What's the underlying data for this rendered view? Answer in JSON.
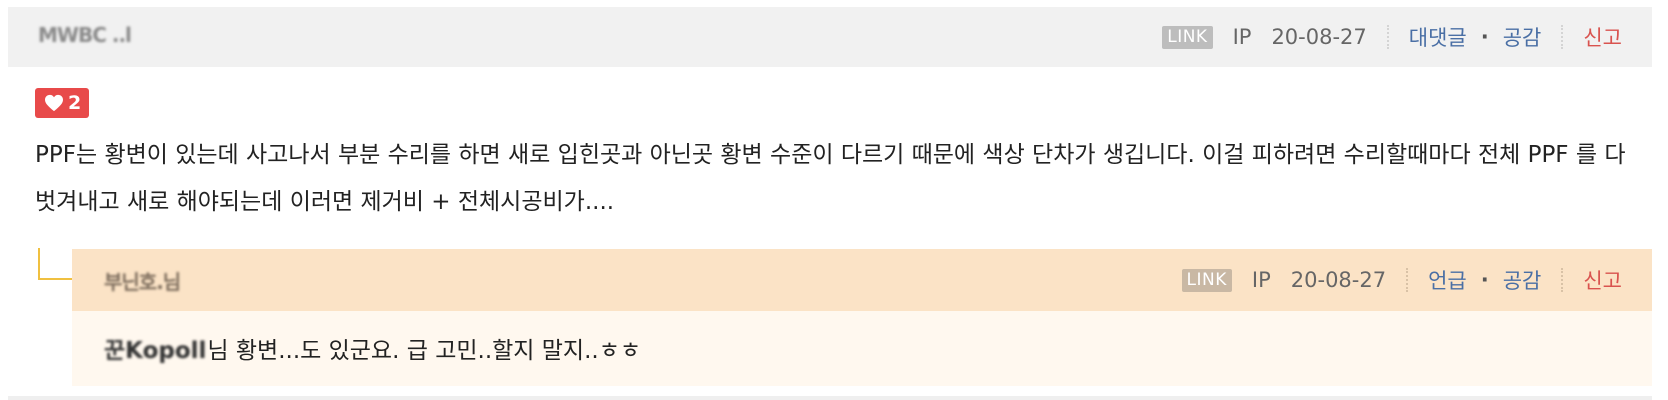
{
  "comment": {
    "nickname": "MWBC ..l",
    "meta": {
      "link_label": "LINK",
      "ip_label": "IP",
      "date": "20-08-27",
      "reply_label": "대댓글",
      "separator": "·",
      "like_label": "공감",
      "report_label": "신고"
    },
    "likes": "2",
    "text": "PPF는 황변이 있는데 사고나서 부분 수리를 하면 새로 입힌곳과 아닌곳 황변 수준이 다르기 때문에 색상 단차가 생깁니다. 이걸 피하려면 수리할때마다 전체 PPF 를 다 벗겨내고 새로 해야되는데 이러면 제거비 + 전체시공비가...."
  },
  "reply": {
    "nickname": "부닌호.님",
    "meta": {
      "link_label": "LINK",
      "ip_label": "IP",
      "date": "20-08-27",
      "mention_label": "언급",
      "separator": "·",
      "like_label": "공감",
      "report_label": "신고"
    },
    "mention": "꾼Kopoll",
    "text": "님 황변...도 있군요. 급 고민..할지 말지..ㅎㅎ"
  },
  "colors": {
    "like_badge": "#e84a4a",
    "header_bg": "#f1f1f1",
    "reply_header_bg": "#fbe3c6",
    "reply_body_bg": "#fff8ef",
    "action_blue": "#4a6fa5",
    "report_red": "#d9534f"
  }
}
